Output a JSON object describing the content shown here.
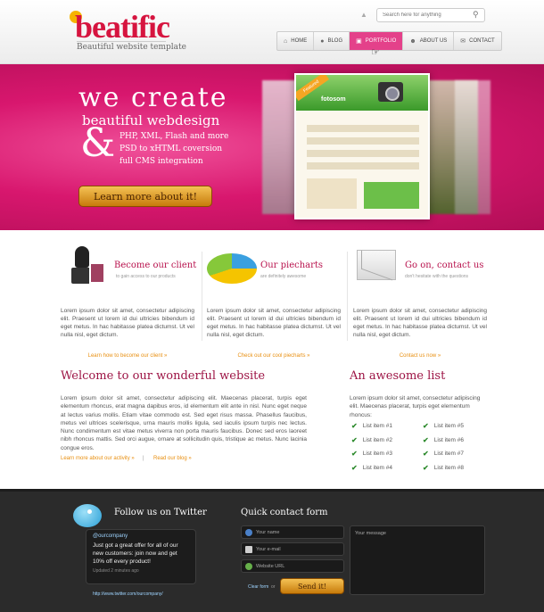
{
  "header": {
    "logo_text": "beatific",
    "tagline": "Beautiful website template",
    "search_placeholder": "Search here for anything",
    "nav": [
      {
        "label": "HOME",
        "icon": "home-icon"
      },
      {
        "label": "BLOG",
        "icon": "chat-icon"
      },
      {
        "label": "PORTFOLIO",
        "icon": "portfolio-icon",
        "active": true
      },
      {
        "label": "ABOUT US",
        "icon": "users-icon"
      },
      {
        "label": "CONTACT",
        "icon": "mail-icon"
      }
    ]
  },
  "hero": {
    "line1": "we create",
    "line2": "beautiful webdesign",
    "amp": "&",
    "features": [
      "PHP, XML, Flash and more",
      "PSD to xHTML coversion",
      "full CMS integration"
    ],
    "button": "Learn more about it!",
    "ribbon": "Featured",
    "shot_logo": "fotosom"
  },
  "features": [
    {
      "title": "Become our client",
      "subtitle": "to gain access to our products",
      "body": "Lorem ipsum dolor sit amet, consectetur adipiscing elit. Praesent ut lorem id dui ultricies bibendum id eget metus. In hac habitasse platea dictumst. Ut vel nulla nisl, eget dictum.",
      "link": "Learn how to become our client »",
      "icon": "speaker-icon"
    },
    {
      "title": "Our piecharts",
      "subtitle": "are definitely awesome",
      "body": "Lorem ipsum dolor sit amet, consectetur adipiscing elit. Praesent ut lorem id dui ultricies bibendum id eget metus. In hac habitasse platea dictumst. Ut vel nulla nisl, eget dictum.",
      "link": "Check out our cool piecharts »",
      "icon": "pie-chart-icon"
    },
    {
      "title": "Go on, contact us",
      "subtitle": "don't hesitate with the questions",
      "body": "Lorem ipsum dolor sit amet, consectetur adipiscing elit. Praesent ut lorem id dui ultricies bibendum id eget metus. In hac habitasse platea dictumst. Ut vel nulla nisl, eget dictum.",
      "link": "Contact us now »",
      "icon": "envelope-icon"
    }
  ],
  "welcome": {
    "title": "Welcome to our wonderful website",
    "body": "Lorem ipsum dolor sit amet, consectetur adipiscing elit. Maecenas placerat, turpis eget elementum rhoncus, erat magna dapibus eros, id elementum elit ante in nisl. Nunc eget neque at lectus varius mollis. Etiam vitae commodo est. Sed eget risus massa. Phasellus faucibus, metus vel ultrices scelerisque, urna mauris mollis ligula, sed iaculis ipsum turpis nec lectus. Nunc condimentum est vitae metus viverra non porta mauris faucibus. Donec sed eros laoreet nibh rhoncus mattis. Sed orci augue, ornare at sollicitudin quis, tristique ac metus. Nunc lacinia congue eros.",
    "link1": "Learn more about our activity »",
    "separator": "|",
    "link2": "Read our blog »"
  },
  "awesome_list": {
    "title": "An awesome list",
    "body": "Lorem ipsum dolor sit amet, consectetur adipiscing elit. Maecenas placerat, turpis eget elementum rhoncus:",
    "col1": [
      "List item #1",
      "List item #2",
      "List item #3",
      "List item #4"
    ],
    "col2": [
      "List item #5",
      "List item #6",
      "List item #7",
      "List item #8"
    ]
  },
  "footer": {
    "follow_title": "Follow us on Twitter",
    "tweet_handle": "@ourcompany",
    "tweet_text": "Just got a great offer for all of our new customers: join now and get 10% off every product!",
    "tweet_time": "Updated 2 minutes ago",
    "twitter_link": "http://www.twitter.com/ourcompany/",
    "form_title": "Quick contact form",
    "name_placeholder": "Your name",
    "email_placeholder": "Your e-mail",
    "website_placeholder": "Website URL",
    "message_placeholder": "Your message",
    "clear_link": "Clear form",
    "or": "or",
    "send_button": "Send it!"
  }
}
